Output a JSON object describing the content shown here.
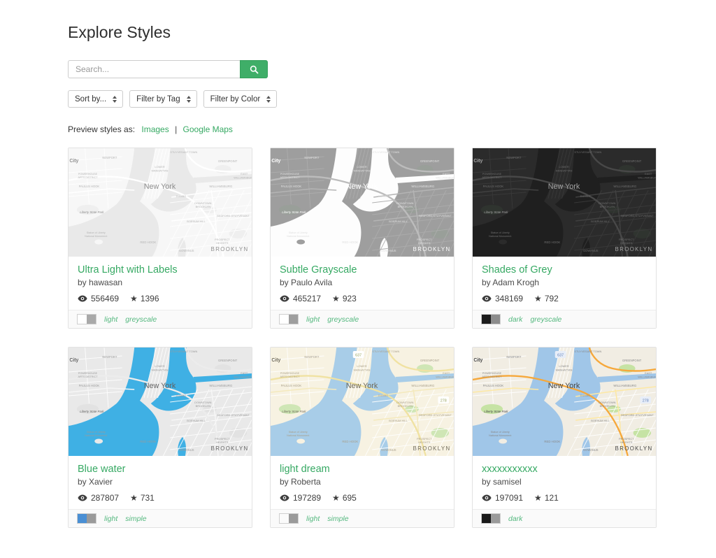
{
  "page": {
    "title": "Explore Styles"
  },
  "search": {
    "placeholder": "Search..."
  },
  "filters": [
    {
      "label": "Sort by..."
    },
    {
      "label": "Filter by Tag"
    },
    {
      "label": "Filter by Color"
    }
  ],
  "preview_as": {
    "label": "Preview styles as:",
    "separator": "|",
    "options": [
      {
        "label": "Images"
      },
      {
        "label": "Google Maps"
      }
    ]
  },
  "colors": {
    "accent": "#36a963",
    "tag_green": "#55b87f",
    "search_button": "#3fae68"
  },
  "map": {
    "labels": {
      "city": "City",
      "newport": "NEWPORT",
      "stuyvesant_town": "STUYVESANT TOWN",
      "greenpoint": "GREENPOINT",
      "lower": "LOWER",
      "manhattan": "MANHATTAN",
      "new_york": "New York",
      "powerhouse": "POWERHOUSE",
      "arts_district": "ARTS DISTRICT",
      "paulus_hook": "PAULUS HOOK",
      "east": "EAST",
      "williamsburg_e": "WILLIAMSBURG",
      "williamsburg": "WILLIAMSBURG",
      "liberty_state_park": "Liberty State Park",
      "dumbo": "DUMBO",
      "downtown": "DOWNTOWN",
      "brooklyn_small": "BROOKLYN",
      "boerum_hill": "BOERUM HILL",
      "bed_stuy": "BEDFORD-STUYVESANT",
      "red_hook": "RED HOOK",
      "gowanus": "GOWANUS",
      "prospect": "PROSPECT",
      "heights": "HEIGHTS",
      "brooklyn": "BROOKLYN",
      "statue1": "Statue of Liberty",
      "statue2": "National Monument",
      "shield1": "278",
      "shield2": "637"
    }
  },
  "cards": [
    {
      "title": "Ultra Light with Labels",
      "author": "by hawasan",
      "views": "556469",
      "stars": "1396",
      "tags": [
        "light",
        "greyscale"
      ],
      "swatches": [
        "background:#ffffff",
        "background:#a9a9a9"
      ],
      "map_css": "--land:#f7f7f7;--water:#e9e9e9;--road:#ffffff;--road2:#ffffff;--hw:#ffffff;--park:#efefef;--txt:#b5b5b5;--txt2:#8e8e8e"
    },
    {
      "title": "Subtle Grayscale",
      "author": "by Paulo Avila",
      "views": "465217",
      "stars": "923",
      "tags": [
        "light",
        "greyscale"
      ],
      "swatches": [
        "background:#ffffff",
        "background:#9e9e9e"
      ],
      "map_css": "--land:#9e9e9e;--water:#fdfdfd;--road:#adadad;--road2:#b4b4b4;--hw:#bcbcbc;--park:#999f99;--txt:#e0e0e0;--txt2:#ffffff"
    },
    {
      "title": "Shades of Grey",
      "author": "by Adam Krogh",
      "views": "348169",
      "stars": "792",
      "tags": [
        "dark",
        "greyscale"
      ],
      "swatches": [
        "background:#1c1c1c",
        "background:#8c8c8c"
      ],
      "map_css": "--land:#2b2b2b;--water:#1f1f1f;--road:#3a3a3a;--road2:#404040;--hw:#484848;--park:#2f342f;--txt:#6f6f6f;--txt2:#a3a3a3"
    },
    {
      "title": "Blue water",
      "author": "by Xavier",
      "views": "287807",
      "stars": "731",
      "tags": [
        "light",
        "simple"
      ],
      "swatches": [
        "background:#4a8fd4",
        "background:#9a9a9a"
      ],
      "map_css": "--land:#e9e9e9;--water:#3fb0e4;--road:#ffffff;--road2:#f6f6f6;--hw:#ececec;--park:#e2e2e2;--txt:#9a9a9a;--txt2:#636363"
    },
    {
      "title": "light dream",
      "author": "by Roberta",
      "views": "197289",
      "stars": "695",
      "tags": [
        "light",
        "simple"
      ],
      "swatches": [
        "background:linear-gradient(90deg,#d43a3a,#e8a javascript0,#3cb43c,#2a4fc0)",
        "background:#9a9a9a"
      ],
      "map_css": "--land:#f7f2e2;--water:#a8cde8;--road:#ffffff;--road2:#f4e9bd;--hw:#f0e2a2;--park:#cfe6b5;--txt:#a89f8a;--txt2:#6f6a5a;--shield:#ffffff;--shieldtxt:#97a35c"
    },
    {
      "title": "xxxxxxxxxxx",
      "author": "by samisel",
      "views": "197091",
      "stars": "121",
      "tags": [
        "dark"
      ],
      "swatches": [
        "background:#1a1a1a",
        "background:#9a9a9a"
      ],
      "map_css": "--land:#f1ede3;--water:#a0c6e8;--road:#ffffff;--road2:#fde8a4;--hw:#f6a83b;--park:#c6e3a4;--txt:#8a8a8a;--txt2:#474747;--shield:#e8eef8;--shieldtxt:#5b7db8"
    }
  ]
}
